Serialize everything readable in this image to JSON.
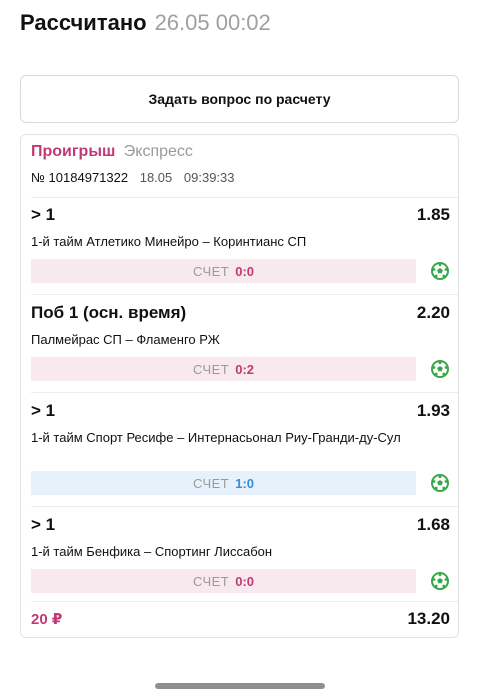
{
  "header": {
    "title": "Рассчитано",
    "datetime": "26.05 00:02"
  },
  "ask_button": {
    "label": "Задать вопрос по расчету"
  },
  "coupon": {
    "result": "Проигрыш",
    "type": "Экспресс",
    "number": "№ 10184971322",
    "date": "18.05",
    "time": "09:39:33",
    "score_label": "СЧЕТ",
    "bets": [
      {
        "outcome": "> 1",
        "coef": "1.85",
        "event": "1-й тайм Атлетико Минейро – Коринтианс СП",
        "score": "0:0",
        "status": "lost",
        "icon": "football-icon"
      },
      {
        "outcome": "Поб 1 (осн. время)",
        "coef": "2.20",
        "event": "Палмейрас СП – Фламенго РЖ",
        "score": "0:2",
        "status": "lost",
        "icon": "football-icon"
      },
      {
        "outcome": "> 1",
        "coef": "1.93",
        "event": "1-й тайм Спорт Ресифе – Интернасьонал Риу-Гранди-ду-Сул",
        "score": "1:0",
        "status": "won",
        "icon": "football-icon"
      },
      {
        "outcome": "> 1",
        "coef": "1.68",
        "event": "1-й тайм Бенфика – Спортинг Лиссабон",
        "score": "0:0",
        "status": "lost",
        "icon": "football-icon"
      }
    ],
    "stake": "20 ₽",
    "total_coef": "13.20"
  },
  "colors": {
    "lost": "#c23a73",
    "won": "#3a8bd6",
    "ball": "#3aa64a"
  }
}
